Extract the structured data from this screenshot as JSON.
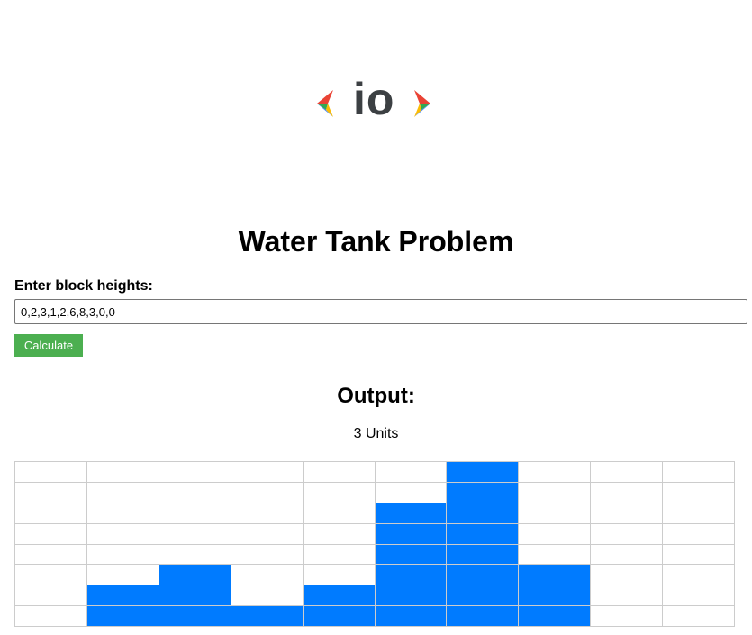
{
  "logo": {
    "text": "io",
    "icons": [
      "chevron-left-icon",
      "chevron-right-icon"
    ],
    "colors": {
      "red": "#ea4335",
      "green": "#34a853",
      "blue": "#4285f4",
      "yellow": "#fbbc05",
      "text": "#3c4043"
    }
  },
  "title": "Water Tank Problem",
  "form": {
    "label": "Enter block heights:",
    "input_value": "0,2,3,1,2,6,8,3,0,0",
    "button_label": "Calculate",
    "button_color": "#4caf50"
  },
  "output": {
    "heading": "Output:",
    "result": "3 Units"
  },
  "visualization": {
    "max_height": 8,
    "heights": [
      0,
      2,
      3,
      1,
      2,
      6,
      8,
      3,
      0,
      0
    ],
    "block_color": "#007bff",
    "grid_line_color": "#cccccc"
  }
}
